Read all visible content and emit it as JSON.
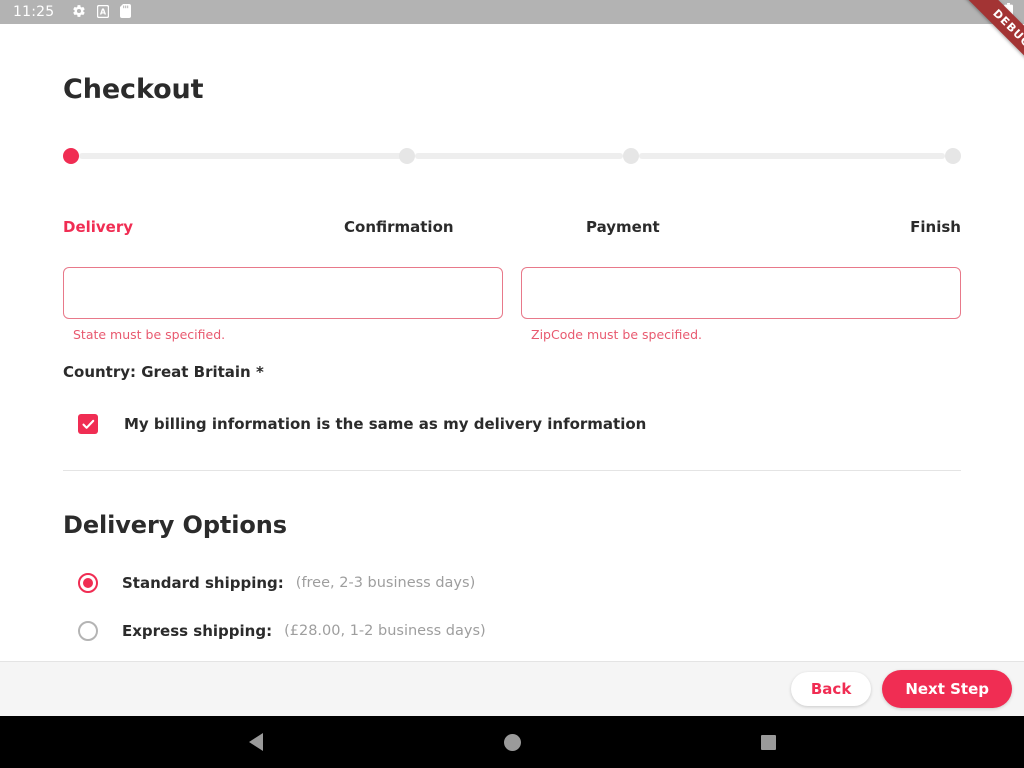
{
  "status_bar": {
    "clock": "11:25",
    "left_icons": [
      "gear-icon",
      "keyboard-a-icon",
      "sd-card-icon"
    ],
    "right_icons": [
      "wifi-icon",
      "battery-icon"
    ]
  },
  "debug_ribbon": {
    "label": "DEBUG",
    "color": "#a33434"
  },
  "page": {
    "title": "Checkout",
    "accent_color": "#f02d53",
    "error_color": "#e8596f"
  },
  "stepper": {
    "steps": [
      {
        "label": "Delivery",
        "active": true
      },
      {
        "label": "Confirmation",
        "active": false
      },
      {
        "label": "Payment",
        "active": false
      },
      {
        "label": "Finish",
        "active": false
      }
    ]
  },
  "form": {
    "fields": [
      {
        "name": "state",
        "value": "",
        "placeholder": "",
        "error": "State must be specified."
      },
      {
        "name": "zipcode",
        "value": "",
        "placeholder": "",
        "error": "ZipCode must be specified."
      }
    ],
    "country_line": "Country: Great Britain *",
    "billing_checkbox": {
      "label": "My billing information is the same as my delivery information",
      "checked": true
    }
  },
  "delivery_options": {
    "title": "Delivery Options",
    "options": [
      {
        "name": "Standard shipping:",
        "detail": "(free, 2-3 business days)",
        "selected": true
      },
      {
        "name": "Express shipping:",
        "detail": "(£28.00, 1-2 business days)",
        "selected": false
      }
    ]
  },
  "action_bar": {
    "back_label": "Back",
    "next_label": "Next Step"
  },
  "nav_bar": {
    "buttons": [
      "back-icon",
      "home-icon",
      "recents-icon"
    ]
  }
}
